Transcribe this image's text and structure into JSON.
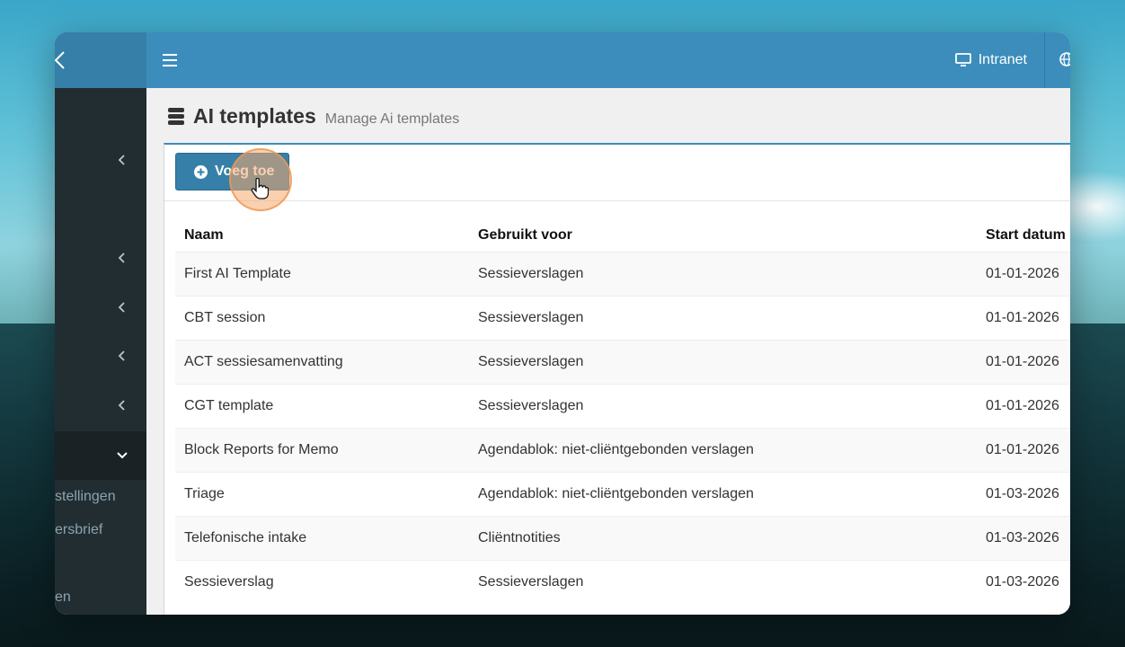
{
  "topbar": {
    "intranet_label": "Intranet"
  },
  "sidebar": {
    "sub_items": [
      "stellingen",
      "ersbrief",
      "en"
    ]
  },
  "page": {
    "title": "AI templates",
    "subtitle": "Manage Ai templates"
  },
  "toolbar": {
    "add_label": "Voeg toe"
  },
  "table": {
    "headers": [
      "Naam",
      "Gebruikt voor",
      "Start datum"
    ],
    "rows": [
      [
        "First AI Template",
        "Sessieverslagen",
        "01-01-2026"
      ],
      [
        "CBT session",
        "Sessieverslagen",
        "01-01-2026"
      ],
      [
        "ACT sessiesamenvatting",
        "Sessieverslagen",
        "01-01-2026"
      ],
      [
        "CGT template",
        "Sessieverslagen",
        "01-01-2026"
      ],
      [
        "Block Reports for Memo",
        "Agendablok: niet-cliëntgebonden verslagen",
        "01-01-2026"
      ],
      [
        "Triage",
        "Agendablok: niet-cliëntgebonden verslagen",
        "01-03-2026"
      ],
      [
        "Telefonische intake",
        "Cliëntnotities",
        "01-03-2026"
      ],
      [
        "Sessieverslag",
        "Sessieverslagen",
        "01-03-2026"
      ]
    ]
  },
  "colors": {
    "primary": "#3c8dbc",
    "sidebar": "#222d32",
    "button": "#367fa9"
  }
}
